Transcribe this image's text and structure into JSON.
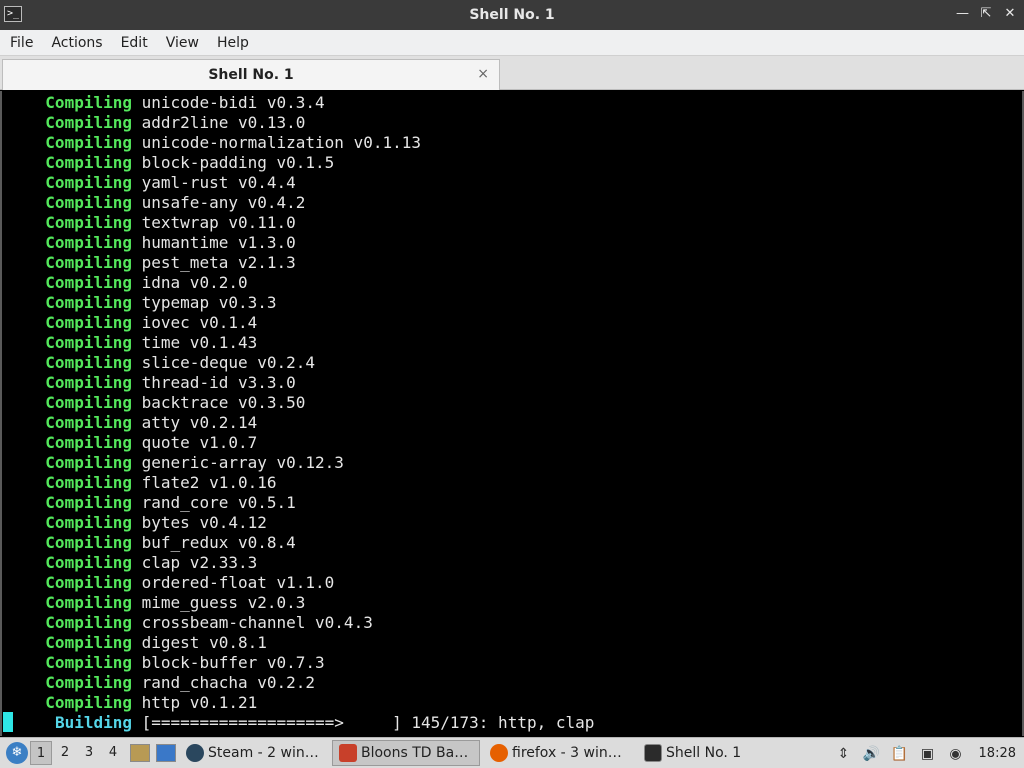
{
  "window": {
    "title": "Shell No. 1",
    "icon": "terminal-icon",
    "controls": [
      "minimize-icon",
      "maximize-icon",
      "close-icon"
    ]
  },
  "menu": [
    "File",
    "Actions",
    "Edit",
    "View",
    "Help"
  ],
  "tab": {
    "label": "Shell No. 1",
    "close": "×"
  },
  "terminal": {
    "lines": [
      {
        "verb": "Compiling",
        "arg": "unicode-bidi v0.3.4"
      },
      {
        "verb": "Compiling",
        "arg": "addr2line v0.13.0"
      },
      {
        "verb": "Compiling",
        "arg": "unicode-normalization v0.1.13"
      },
      {
        "verb": "Compiling",
        "arg": "block-padding v0.1.5"
      },
      {
        "verb": "Compiling",
        "arg": "yaml-rust v0.4.4"
      },
      {
        "verb": "Compiling",
        "arg": "unsafe-any v0.4.2"
      },
      {
        "verb": "Compiling",
        "arg": "textwrap v0.11.0"
      },
      {
        "verb": "Compiling",
        "arg": "humantime v1.3.0"
      },
      {
        "verb": "Compiling",
        "arg": "pest_meta v2.1.3"
      },
      {
        "verb": "Compiling",
        "arg": "idna v0.2.0"
      },
      {
        "verb": "Compiling",
        "arg": "typemap v0.3.3"
      },
      {
        "verb": "Compiling",
        "arg": "iovec v0.1.4"
      },
      {
        "verb": "Compiling",
        "arg": "time v0.1.43"
      },
      {
        "verb": "Compiling",
        "arg": "slice-deque v0.2.4"
      },
      {
        "verb": "Compiling",
        "arg": "thread-id v3.3.0"
      },
      {
        "verb": "Compiling",
        "arg": "backtrace v0.3.50"
      },
      {
        "verb": "Compiling",
        "arg": "atty v0.2.14"
      },
      {
        "verb": "Compiling",
        "arg": "quote v1.0.7"
      },
      {
        "verb": "Compiling",
        "arg": "generic-array v0.12.3"
      },
      {
        "verb": "Compiling",
        "arg": "flate2 v1.0.16"
      },
      {
        "verb": "Compiling",
        "arg": "rand_core v0.5.1"
      },
      {
        "verb": "Compiling",
        "arg": "bytes v0.4.12"
      },
      {
        "verb": "Compiling",
        "arg": "buf_redux v0.8.4"
      },
      {
        "verb": "Compiling",
        "arg": "clap v2.33.3"
      },
      {
        "verb": "Compiling",
        "arg": "ordered-float v1.1.0"
      },
      {
        "verb": "Compiling",
        "arg": "mime_guess v2.0.3"
      },
      {
        "verb": "Compiling",
        "arg": "crossbeam-channel v0.4.3"
      },
      {
        "verb": "Compiling",
        "arg": "digest v0.8.1"
      },
      {
        "verb": "Compiling",
        "arg": "block-buffer v0.7.3"
      },
      {
        "verb": "Compiling",
        "arg": "rand_chacha v0.2.2"
      },
      {
        "verb": "Compiling",
        "arg": "http v0.1.21"
      }
    ],
    "building": {
      "verb": "Building",
      "arg": "[===================>     ] 145/173: http, clap"
    },
    "colors": {
      "compiling": "#54e85c",
      "building": "#55d6e8",
      "cursor": "#2ee6e6"
    }
  },
  "taskbar": {
    "start_icon": "lxqt-start-icon",
    "workspaces": [
      "1",
      "2",
      "3",
      "4"
    ],
    "active_workspace": "1",
    "quicklaunch": [
      "file-manager-icon",
      "show-desktop-icon"
    ],
    "tasks": [
      {
        "label": "Steam - 2 wind...",
        "icon": "steam-icon",
        "color": "#2a475e",
        "active": false
      },
      {
        "label": "Bloons TD Batt...",
        "icon": "bloons-icon",
        "color": "#c8402a",
        "active": true
      },
      {
        "label": "firefox - 3 wind...",
        "icon": "firefox-icon",
        "color": "#e66000",
        "active": false
      },
      {
        "label": "Shell No. 1",
        "icon": "terminal-icon",
        "color": "#2b2b2b",
        "active": false
      }
    ],
    "tray": [
      "scroll-icon",
      "volume-icon",
      "clipboard-icon",
      "network-icon",
      "steam-tray-icon"
    ],
    "clock": "18:28"
  }
}
